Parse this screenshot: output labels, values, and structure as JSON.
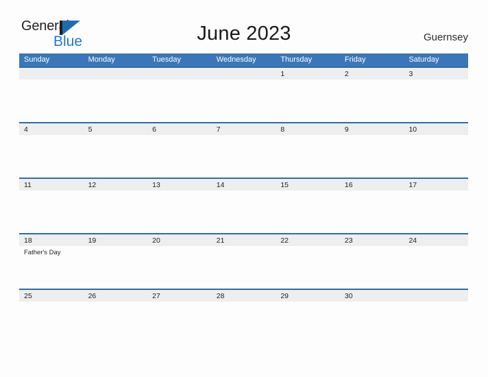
{
  "brand": {
    "word_general": "General",
    "word_blue": "Blue",
    "mark_name": "general-blue-triangle-logo",
    "color_blue": "#1f7ac8",
    "color_dark": "#231f20"
  },
  "header": {
    "title": "June 2023",
    "country": "Guernsey"
  },
  "theme": {
    "header_blue": "#3b76b8",
    "row_rule_blue": "#2b6da8",
    "stripe_gray": "#eeeeee",
    "page_bg": "#fdfdfd",
    "text": "#1d1d1d"
  },
  "calendar": {
    "weekdays": [
      "Sunday",
      "Monday",
      "Tuesday",
      "Wednesday",
      "Thursday",
      "Friday",
      "Saturday"
    ],
    "weeks": [
      [
        {
          "day": "",
          "event": ""
        },
        {
          "day": "",
          "event": ""
        },
        {
          "day": "",
          "event": ""
        },
        {
          "day": "",
          "event": ""
        },
        {
          "day": "1",
          "event": ""
        },
        {
          "day": "2",
          "event": ""
        },
        {
          "day": "3",
          "event": ""
        }
      ],
      [
        {
          "day": "4",
          "event": ""
        },
        {
          "day": "5",
          "event": ""
        },
        {
          "day": "6",
          "event": ""
        },
        {
          "day": "7",
          "event": ""
        },
        {
          "day": "8",
          "event": ""
        },
        {
          "day": "9",
          "event": ""
        },
        {
          "day": "10",
          "event": ""
        }
      ],
      [
        {
          "day": "11",
          "event": ""
        },
        {
          "day": "12",
          "event": ""
        },
        {
          "day": "13",
          "event": ""
        },
        {
          "day": "14",
          "event": ""
        },
        {
          "day": "15",
          "event": ""
        },
        {
          "day": "16",
          "event": ""
        },
        {
          "day": "17",
          "event": ""
        }
      ],
      [
        {
          "day": "18",
          "event": "Father's Day"
        },
        {
          "day": "19",
          "event": ""
        },
        {
          "day": "20",
          "event": ""
        },
        {
          "day": "21",
          "event": ""
        },
        {
          "day": "22",
          "event": ""
        },
        {
          "day": "23",
          "event": ""
        },
        {
          "day": "24",
          "event": ""
        }
      ],
      [
        {
          "day": "25",
          "event": ""
        },
        {
          "day": "26",
          "event": ""
        },
        {
          "day": "27",
          "event": ""
        },
        {
          "day": "28",
          "event": ""
        },
        {
          "day": "29",
          "event": ""
        },
        {
          "day": "30",
          "event": ""
        },
        {
          "day": "",
          "event": ""
        }
      ]
    ]
  }
}
